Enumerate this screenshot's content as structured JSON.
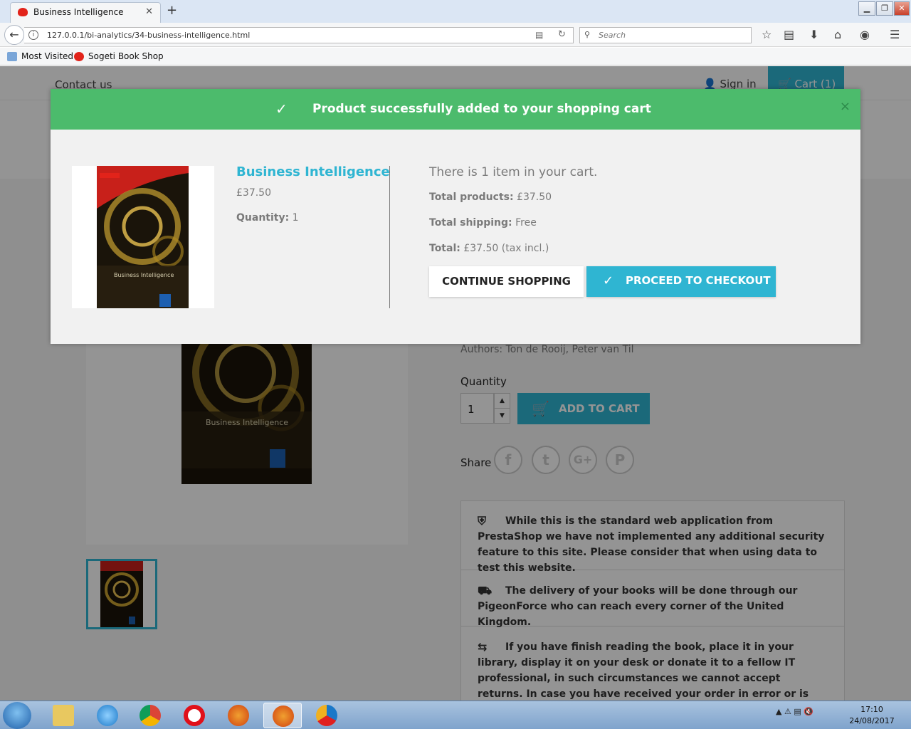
{
  "browser": {
    "tab_title": "Business Intelligence",
    "tab_close": "✕",
    "new_tab": "+",
    "url": "127.0.0.1/bi-analytics/34-business-intelligence.html",
    "search_placeholder": "Search",
    "window_buttons": [
      "▁",
      "❐",
      "✕"
    ],
    "bookmarks": [
      "Most Visited",
      "Sogeti Book Shop"
    ]
  },
  "site": {
    "contact": "Contact us",
    "sign_in": "Sign in",
    "cart": "Cart (1)"
  },
  "product_page": {
    "authors": "Authors: Ton de Rooij, Peter van Til",
    "quantity_label": "Quantity",
    "quantity_value": "1",
    "add_to_cart": "ADD TO CART",
    "share_label": "Share",
    "social": [
      "f",
      "t",
      "G+",
      "P"
    ],
    "reassurance": [
      "While this is the standard web application from PrestaShop we have not implemented any additional security feature to this site. Please consider that when using data to test this website.",
      "The delivery of your books will be done through our PigeonForce who can reach every corner of the United Kingdom.",
      "If you have finish reading the book, place it in your library, display it on your desk or donate it to a fellow IT professional, in such circumstances we cannot accept returns. In case you have received your order in error or is damaged please contact our"
    ]
  },
  "modal": {
    "title": "Product successfully added to your shopping cart",
    "close": "×",
    "product_name": "Business Intelligence",
    "product_price": "£37.50",
    "quantity_label": "Quantity:",
    "quantity_value": "1",
    "cart_count_text": "There is 1 item in your cart.",
    "total_products_label": "Total products:",
    "total_products_value": "£37.50",
    "total_shipping_label": "Total shipping:",
    "total_shipping_value": "Free",
    "total_label": "Total:",
    "total_value": "£37.50 (tax incl.)",
    "continue_button": "CONTINUE SHOPPING",
    "checkout_button": "PROCEED TO CHECKOUT"
  },
  "book_cover": {
    "title": "Business Intelligence"
  },
  "taskbar": {
    "time": "17:10",
    "date": "24/08/2017"
  },
  "colors": {
    "accent": "#2fb5d2",
    "success": "#4cbb6c"
  }
}
